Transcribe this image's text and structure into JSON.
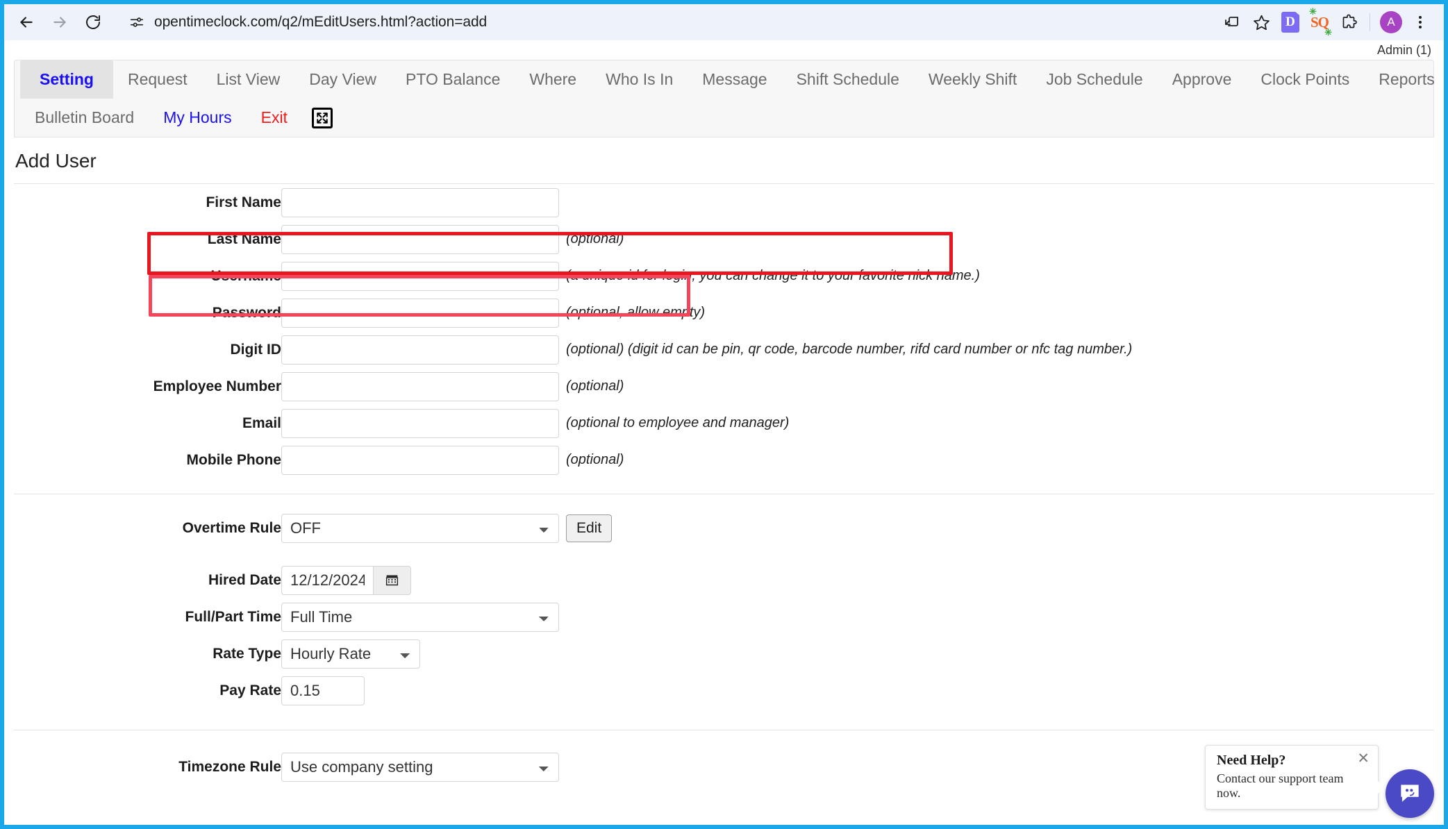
{
  "browser": {
    "url": "opentimeclock.com/q2/mEditUsers.html?action=add",
    "back_label": "Back",
    "forward_label": "Forward",
    "reload_label": "Reload",
    "site_info_label": "View site information",
    "install_label": "Install page as app",
    "bookmark_label": "Bookmark this tab",
    "ext_d_label": "D",
    "ext_sq_label": "SQ",
    "ext_puzzle_label": "Extensions",
    "profile_label": "A",
    "menu_label": "Customize and control Chrome"
  },
  "app": {
    "admin_label": "Admin (1)",
    "nav_row1": [
      {
        "label": "Setting",
        "state": "active"
      },
      {
        "label": "Request",
        "state": "normal"
      },
      {
        "label": "List View",
        "state": "normal"
      },
      {
        "label": "Day View",
        "state": "normal"
      },
      {
        "label": "PTO Balance",
        "state": "normal"
      },
      {
        "label": "Where",
        "state": "normal"
      },
      {
        "label": "Who Is In",
        "state": "normal"
      },
      {
        "label": "Message",
        "state": "normal"
      },
      {
        "label": "Shift Schedule",
        "state": "normal"
      },
      {
        "label": "Weekly Shift",
        "state": "normal"
      },
      {
        "label": "Job Schedule",
        "state": "normal"
      },
      {
        "label": "Approve",
        "state": "normal"
      },
      {
        "label": "Clock Points",
        "state": "normal"
      },
      {
        "label": "Reports",
        "state": "normal"
      }
    ],
    "nav_row2": [
      {
        "label": "Bulletin Board",
        "state": "normal"
      },
      {
        "label": "My Hours",
        "state": "blue"
      },
      {
        "label": "Exit",
        "state": "red"
      }
    ],
    "expand_icon": "fullscreen-icon",
    "page_title": "Add User"
  },
  "form": {
    "first_name": {
      "label": "First Name",
      "value": "",
      "hint": ""
    },
    "last_name": {
      "label": "Last Name",
      "value": "",
      "hint": "(optional)"
    },
    "username": {
      "label": "Username",
      "value": "",
      "hint": "(a unique id for login, you can change it to your favorite nick name.)"
    },
    "password": {
      "label": "Password",
      "value": "",
      "hint": "(optional, allow empty)"
    },
    "digit_id": {
      "label": "Digit ID",
      "value": "",
      "hint": "(optional) (digit id can be pin, qr code, barcode number, rifd card number or nfc tag number.)"
    },
    "employee_number": {
      "label": "Employee Number",
      "value": "",
      "hint": "(optional)"
    },
    "email": {
      "label": "Email",
      "value": "",
      "hint": "(optional to employee and manager)"
    },
    "mobile_phone": {
      "label": "Mobile Phone",
      "value": "",
      "hint": "(optional)"
    },
    "overtime_rule": {
      "label": "Overtime Rule",
      "value": "OFF",
      "edit_label": "Edit"
    },
    "hired_date": {
      "label": "Hired Date",
      "value": "12/12/2024",
      "calendar_icon": "calendar-icon"
    },
    "full_part_time": {
      "label": "Full/Part Time",
      "value": "Full Time"
    },
    "rate_type": {
      "label": "Rate Type",
      "value": "Hourly Rate"
    },
    "pay_rate": {
      "label": "Pay Rate",
      "value": "0.15"
    },
    "timezone_rule": {
      "label": "Timezone Rule",
      "value": "Use company setting"
    }
  },
  "highlights": {
    "username_color": "#e8161f",
    "password_color": "#f4465a"
  },
  "chat": {
    "title": "Need Help?",
    "subtitle": "Contact our support team now.",
    "close_label": "✕",
    "fab_icon": "chat-icon",
    "fab_color": "#4a49c6"
  }
}
